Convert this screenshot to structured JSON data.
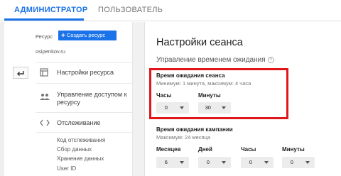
{
  "tabs": {
    "admin": "АДМИНИСТРАТОР",
    "user": "ПОЛЬЗОВАТЕЛЬ"
  },
  "accent_color": "#1a73e8",
  "highlight_color": "#e0161b",
  "sidebar": {
    "resource_label": "Ресурс",
    "create_button": "Создать ресурс",
    "site": "osipenkov.ru",
    "back_icon": "back-arrow-icon",
    "items": [
      {
        "icon": "page-icon",
        "label": "Настройки ресурса"
      },
      {
        "icon": "people-icon",
        "label_line1": "Управление доступом к",
        "label_line2": "ресурсу"
      },
      {
        "icon": "code-icon",
        "label": "Отслеживание"
      }
    ],
    "sub_items": [
      "Код отслеживания",
      "Сбор данных",
      "Хранение данных",
      "User ID"
    ]
  },
  "main": {
    "title": "Настройки сеанса",
    "subtitle": "Управление временем ожидания",
    "session": {
      "title": "Время ожидания сеанса",
      "hint": "Минимум: 1 минута, максимум: 4 часа",
      "hours_label": "Часы",
      "hours_value": "0",
      "minutes_label": "Минуты",
      "minutes_value": "30"
    },
    "campaign": {
      "title": "Время ожидания кампании",
      "hint": "Максимум: 24 месяца",
      "months_label": "Месяцев",
      "months_value": "6",
      "days_label": "Дней",
      "days_value": "0",
      "hours_label": "Часы",
      "hours_value": "0",
      "minutes_label": "Минуты",
      "minutes_value": "0"
    }
  }
}
